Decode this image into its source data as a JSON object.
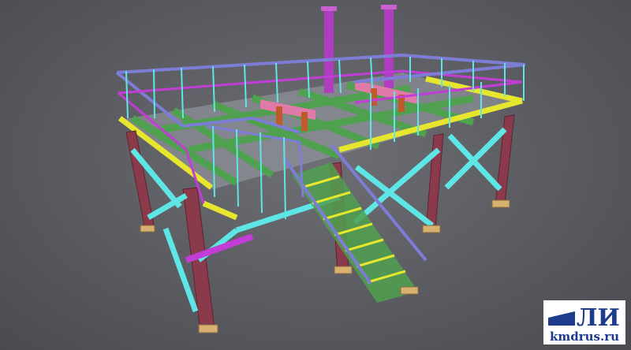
{
  "scene": {
    "subject": "steel-structure-platform-3d-model",
    "colors": {
      "background": "#5e5f64",
      "columns": "#8a3a4a",
      "bracing": "#5ee6e6",
      "handrails_top": "#7d7dd6",
      "handrails_mid": "#c23cd6",
      "deck_beams": "#4fa04f",
      "edge_beams": "#e6e62e",
      "pipes": "#b03cc0",
      "equipment": "#e07aa8",
      "base_plates": "#d8b070"
    }
  },
  "logo": {
    "mark_text": "ЛИ",
    "url_text": "kmdrus.ru",
    "color": "#1d3c8c"
  }
}
